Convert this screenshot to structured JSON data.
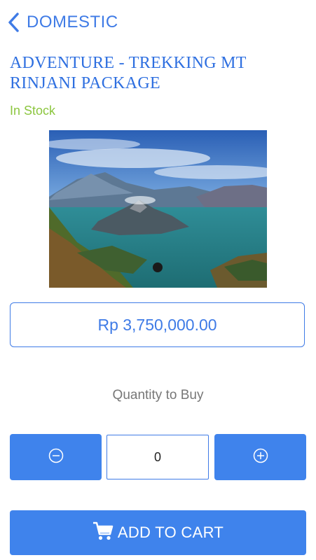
{
  "nav": {
    "back_icon": "chevron-left-icon",
    "label": "DOMESTIC"
  },
  "product": {
    "title": "ADVENTURE - TREKKING MT RINJANI PACKAGE",
    "stock_status": "In Stock",
    "price": "Rp 3,750,000.00"
  },
  "quantity": {
    "label": "Quantity to Buy",
    "value": "0",
    "minus_icon": "minus-circle-icon",
    "plus_icon": "plus-circle-icon"
  },
  "cart": {
    "label": "ADD TO CART",
    "icon": "shopping-cart-icon"
  },
  "colors": {
    "accent": "#3f83ec",
    "stock": "#8cc63f"
  }
}
